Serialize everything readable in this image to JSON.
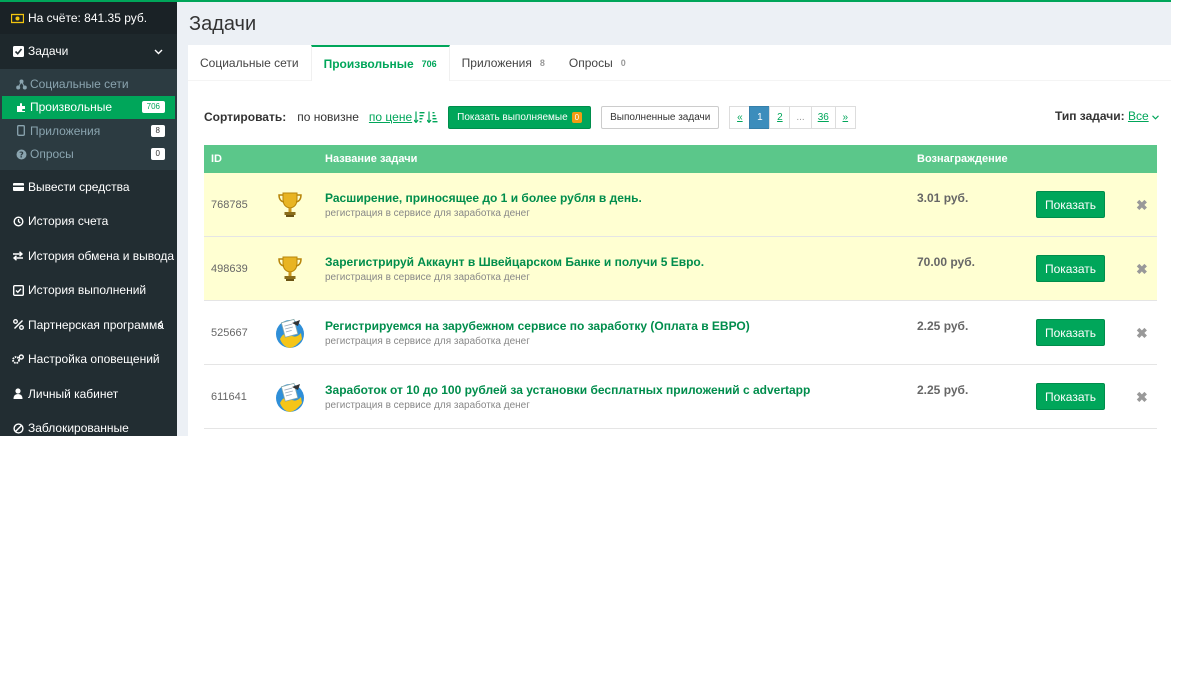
{
  "sidebar": {
    "balance": "На счёте: 841.35 руб.",
    "tasks_label": "Задачи",
    "sub": [
      {
        "label": "Социальные сети",
        "badge": ""
      },
      {
        "label": "Произвольные",
        "badge": "706"
      },
      {
        "label": "Приложения",
        "badge": "8"
      },
      {
        "label": "Опросы",
        "badge": "0"
      }
    ],
    "items": [
      {
        "label": "Вывести средства",
        "icon": "wallet-icon"
      },
      {
        "label": "История счета",
        "icon": "history-icon"
      },
      {
        "label": "История обмена и вывода",
        "icon": "exchange-icon"
      },
      {
        "label": "История выполнений",
        "icon": "check-list-icon"
      },
      {
        "label": "Партнерская программа",
        "icon": "percent-icon"
      },
      {
        "label": "Настройка оповещений",
        "icon": "cogs-icon"
      },
      {
        "label": "Личный кабинет",
        "icon": "user-icon"
      },
      {
        "label": "Заблокированные",
        "icon": "ban-icon"
      }
    ]
  },
  "page": {
    "title": "Задачи"
  },
  "tabs": [
    {
      "label": "Социальные сети",
      "count": ""
    },
    {
      "label": "Произвольные",
      "count": "706"
    },
    {
      "label": "Приложения",
      "count": "8"
    },
    {
      "label": "Опросы",
      "count": "0"
    }
  ],
  "toolbar": {
    "sort_label": "Сортировать:",
    "sort_new": "по новизне",
    "sort_price": "по цене",
    "show_running": "Показать выполняемые",
    "show_running_count": "0",
    "completed": "Выполненные задачи",
    "pager": [
      "«",
      "1",
      "2",
      "...",
      "36",
      "»"
    ],
    "type_label": "Тип задачи:",
    "type_value": "Все"
  },
  "table": {
    "headers": {
      "id": "ID",
      "name": "Название задачи",
      "reward": "Вознаграждение"
    },
    "rows": [
      {
        "id": "768785",
        "title": "Расширение, приносящее до 1 и более рубля в день.",
        "sub": "регистрация в сервисе для заработка денег",
        "price": "3.01 руб.",
        "button": "Показать",
        "icon": "trophy-icon",
        "highlight": true
      },
      {
        "id": "498639",
        "title": "Зарегистрируй Аккаунт в Швейцарском Банке и получи 5 Евро.",
        "sub": "регистрация в сервисе для заработка денег",
        "price": "70.00 руб.",
        "button": "Показать",
        "icon": "trophy-icon",
        "highlight": true
      },
      {
        "id": "525667",
        "title": "Регистрируемся на зарубежном сервисе по заработку (Оплата в ЕВРО)",
        "sub": "регистрация в сервисе для заработка денег",
        "price": "2.25 руб.",
        "button": "Показать",
        "icon": "globe-task-icon",
        "highlight": false
      },
      {
        "id": "611641",
        "title": "Заработок от 10 до 100 рублей за установки бесплатных приложений с advertapp",
        "sub": "регистрация в сервисе для заработка денег",
        "price": "2.25 руб.",
        "button": "Показать",
        "icon": "globe-task-icon",
        "highlight": false
      }
    ]
  }
}
